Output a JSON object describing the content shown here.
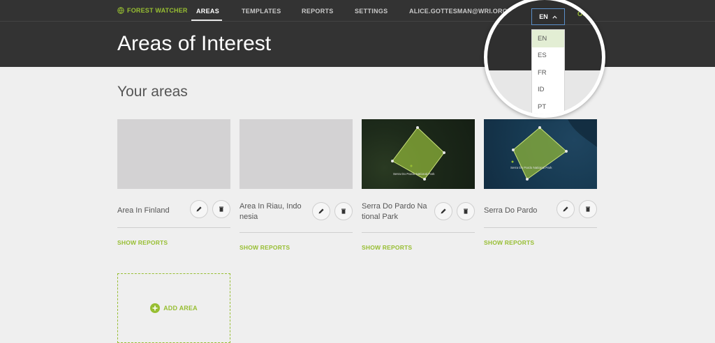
{
  "header": {
    "brand": "FOREST WATCHER",
    "nav": [
      {
        "label": "AREAS",
        "active": true
      },
      {
        "label": "TEMPLATES",
        "active": false
      },
      {
        "label": "REPORTS",
        "active": false
      },
      {
        "label": "SETTINGS",
        "active": false
      }
    ],
    "user_email": "ALICE.GOTTESMAN@WRI.ORG",
    "logout": "LOGOUT",
    "logout_visible": "OGOUT"
  },
  "page_title": "Areas of Interest",
  "section_title": "Your areas",
  "areas": [
    {
      "name": "Area In Finland",
      "show_reports": "SHOW REPORTS"
    },
    {
      "name": "Area In Riau, Indo nesia",
      "show_reports": "SHOW REPORTS"
    },
    {
      "name": "Serra Do Pardo Na tional Park",
      "show_reports": "SHOW REPORTS",
      "map_label": "Serra Do Pardo National Park"
    },
    {
      "name": "Serra Do Pardo",
      "show_reports": "SHOW REPORTS",
      "map_label": "Serra Do Pardo National Park"
    }
  ],
  "add_area": "ADD AREA",
  "language": {
    "current": "EN",
    "options": [
      "EN",
      "ES",
      "FR",
      "ID",
      "PT"
    ]
  },
  "colors": {
    "accent": "#97be32",
    "header_bg": "#333333",
    "page_bg": "#efefef"
  }
}
